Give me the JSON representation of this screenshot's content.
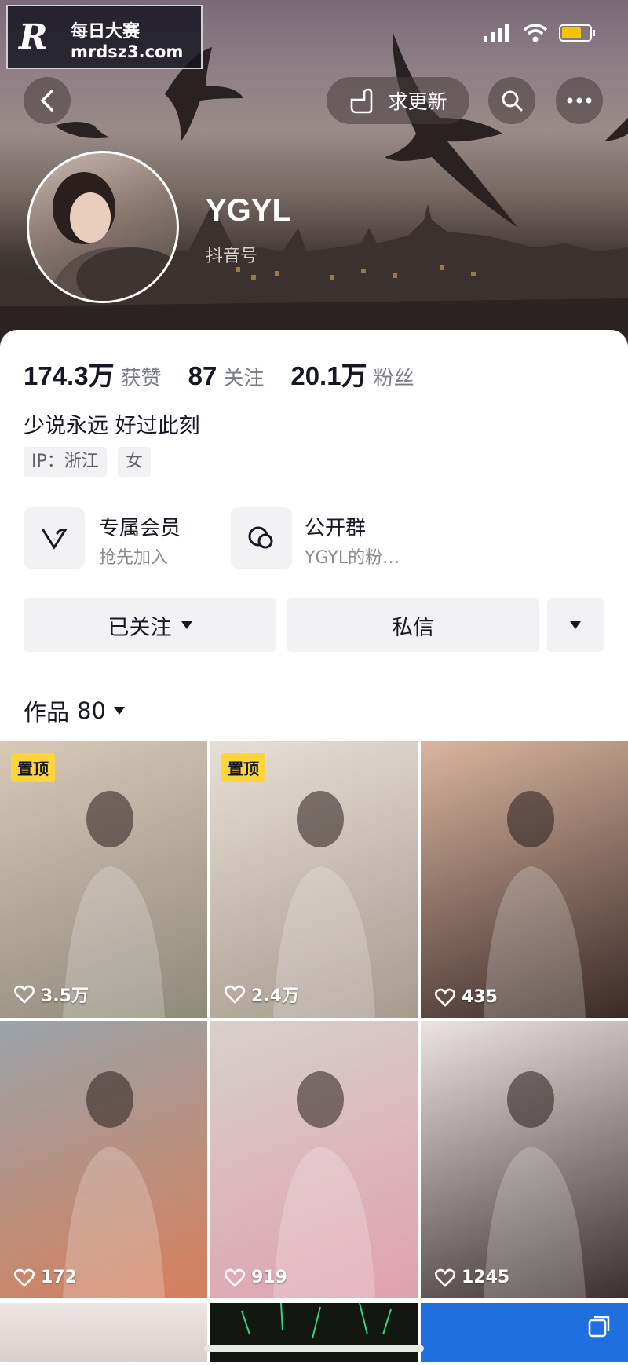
{
  "watermark": {
    "logo": "R",
    "title": "每日大赛",
    "url": "mrdsz3.com"
  },
  "header": {
    "request_update_label": "求更新"
  },
  "profile": {
    "name": "YGYL",
    "douyin_id_label": "抖音号",
    "stats": [
      {
        "value": "174.3万",
        "label": "获赞"
      },
      {
        "value": "87",
        "label": "关注"
      },
      {
        "value": "20.1万",
        "label": "粉丝"
      }
    ],
    "bio": "少说永远 好过此刻",
    "tags": [
      "IP：浙江",
      "女"
    ]
  },
  "features": [
    {
      "title": "专属会员",
      "subtitle": "抢先加入",
      "icon": "vip-v-icon"
    },
    {
      "title": "公开群",
      "subtitle": "YGYL的粉…",
      "icon": "group-chat-icon"
    }
  ],
  "actions": {
    "follow_label": "已关注",
    "message_label": "私信"
  },
  "works": {
    "label": "作品",
    "count": "80"
  },
  "videos": [
    {
      "likes": "3.5万",
      "pinned_label": "置顶",
      "colors": [
        "#d8c8b8",
        "#8f8a7a"
      ]
    },
    {
      "likes": "2.4万",
      "pinned_label": "置顶",
      "colors": [
        "#e6dfd6",
        "#a89a8e"
      ]
    },
    {
      "likes": "435",
      "pinned_label": "",
      "colors": [
        "#d9b6a0",
        "#3b2a26"
      ]
    },
    {
      "likes": "172",
      "pinned_label": "",
      "colors": [
        "#9aa3aa",
        "#d67f5a"
      ]
    },
    {
      "likes": "919",
      "pinned_label": "",
      "colors": [
        "#d7d0cc",
        "#e0a0b0"
      ]
    },
    {
      "likes": "1245",
      "pinned_label": "",
      "colors": [
        "#ece4e2",
        "#3a3030"
      ]
    }
  ],
  "colors": {
    "pin": "#fed43b",
    "text": "#161823",
    "muted": "#7b7d86"
  }
}
